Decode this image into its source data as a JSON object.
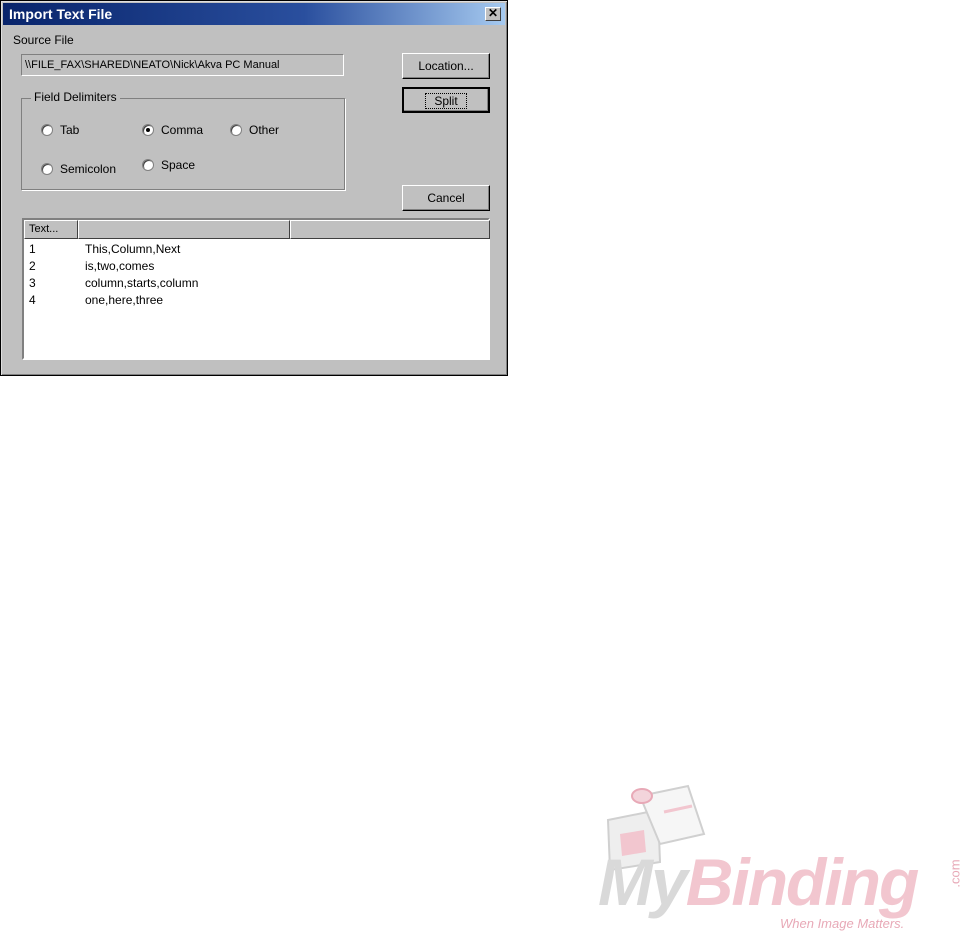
{
  "window": {
    "title": "Import Text File",
    "close_glyph": "✕"
  },
  "source": {
    "label": "Source File",
    "value": "\\\\FILE_FAX\\SHARED\\NEATO\\Nick\\Akva PC Manual"
  },
  "buttons": {
    "location": "Location...",
    "split": "Split",
    "cancel": "Cancel"
  },
  "delimiters": {
    "label": "Field Delimiters",
    "options": [
      {
        "label": "Tab",
        "checked": false
      },
      {
        "label": "Comma",
        "checked": true
      },
      {
        "label": "Other",
        "checked": false
      },
      {
        "label": "Semicolon",
        "checked": false
      },
      {
        "label": "Space",
        "checked": false
      }
    ]
  },
  "list": {
    "columns": [
      "Text...",
      "",
      ""
    ],
    "rows": [
      {
        "num": "1",
        "text": "This,Column,Next"
      },
      {
        "num": "2",
        "text": "is,two,comes"
      },
      {
        "num": "3",
        "text": "column,starts,column"
      },
      {
        "num": "4",
        "text": "one,here,three"
      }
    ]
  },
  "watermark": {
    "brand_part1": "My",
    "brand_part2": "Binding",
    "suffix": ".com",
    "tagline": "When Image Matters."
  }
}
